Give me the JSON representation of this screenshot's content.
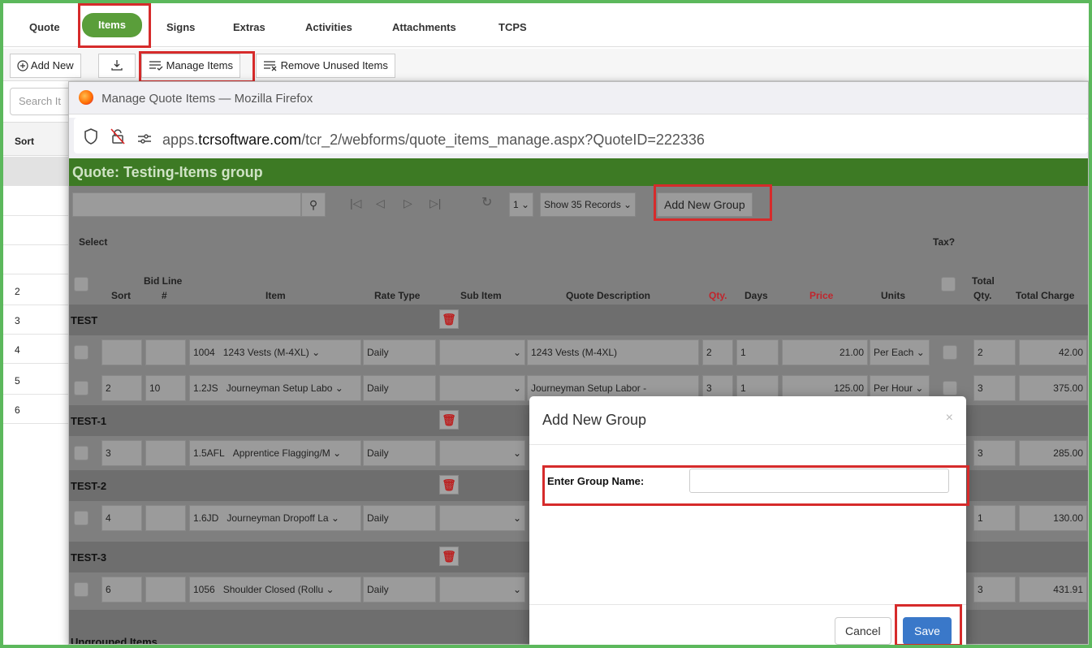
{
  "tabs": [
    "Quote",
    "Items",
    "Signs",
    "Extras",
    "Activities",
    "Attachments",
    "TCPS"
  ],
  "toolbar": {
    "add_new": "Add New",
    "manage_items": "Manage Items",
    "remove_unused": "Remove Unused Items"
  },
  "under": {
    "search_placeholder": "Search It",
    "sort_header": "Sort",
    "rows": [
      "2",
      "3",
      "4",
      "5",
      "6"
    ]
  },
  "firefox": {
    "window_title": "Manage Quote Items — Mozilla Firefox",
    "url_prefix": "apps.",
    "url_domain": "tcrsoftware.com",
    "url_path": "/tcr_2/webforms/quote_items_manage.aspx?QuoteID=222336"
  },
  "quote_title": "Quote: Testing-Items group",
  "pager": {
    "page": "1",
    "records": "Show 35 Records",
    "add_group": "Add New Group"
  },
  "headers": {
    "select": "Select",
    "tax": "Tax?",
    "sort": "Sort",
    "bid_line": "Bid Line",
    "bid_line_hash": "#",
    "item": "Item",
    "rate_type": "Rate Type",
    "sub_item": "Sub Item",
    "description": "Quote Description",
    "qty": "Qty.",
    "days": "Days",
    "price": "Price",
    "units": "Units",
    "total": "Total",
    "total_qty": "Qty.",
    "total_charge": "Total Charge"
  },
  "groups": [
    {
      "name": "TEST",
      "rows": [
        {
          "sort": "",
          "bid": "",
          "code": "1004",
          "item": "1243 Vests (M-4XL)",
          "rate": "Daily",
          "desc": "1243 Vests (M-4XL)",
          "qty": "2",
          "days": "1",
          "price": "21.00",
          "units": "Per Each",
          "tqty": "2",
          "charge": "42.00"
        },
        {
          "sort": "2",
          "bid": "10",
          "code": "1.2JS",
          "item": "Journeyman Setup Labo",
          "rate": "Daily",
          "desc": "Journeyman Setup Labor -",
          "qty": "3",
          "days": "1",
          "price": "125.00",
          "units": "Per Hour",
          "tqty": "3",
          "charge": "375.00"
        }
      ]
    },
    {
      "name": "TEST-1",
      "rows": [
        {
          "sort": "3",
          "bid": "",
          "code": "1.5AFL",
          "item": "Apprentice Flagging/M",
          "rate": "Daily",
          "tqty": "3",
          "charge": "285.00"
        }
      ]
    },
    {
      "name": "TEST-2",
      "rows": [
        {
          "sort": "4",
          "bid": "",
          "code": "1.6JD",
          "item": "Journeyman Dropoff La",
          "rate": "Daily",
          "tqty": "1",
          "charge": "130.00"
        }
      ]
    },
    {
      "name": "TEST-3",
      "rows": [
        {
          "sort": "6",
          "bid": "",
          "code": "1056",
          "item": "Shoulder Closed (Rollu",
          "rate": "Daily",
          "tqty": "3",
          "charge": "431.91"
        }
      ]
    }
  ],
  "ungrouped": "Ungrouped Items",
  "modal": {
    "title": "Add New Group",
    "close": "×",
    "label": "Enter Group Name:",
    "input_value": "",
    "cancel": "Cancel",
    "save": "Save"
  }
}
